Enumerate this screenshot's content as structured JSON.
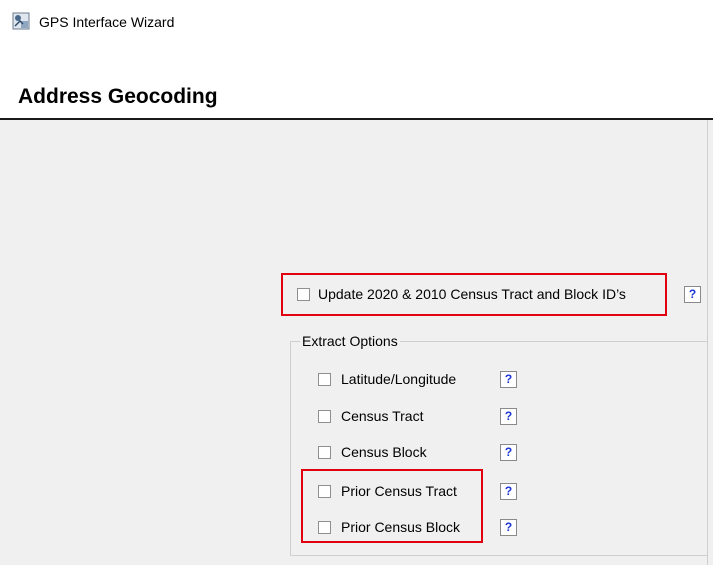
{
  "window": {
    "title": "GPS Interface Wizard",
    "icon": "gps-wizard-app-icon"
  },
  "header": {
    "title": "Address Geocoding"
  },
  "update_option": {
    "label": "Update 2020 & 2010 Census Tract and Block ID’s",
    "checked": false,
    "help": "?"
  },
  "extract_options": {
    "label": "Extract Options",
    "items": [
      {
        "label": "Latitude/Longitude",
        "checked": false,
        "help": "?"
      },
      {
        "label": "Census Tract",
        "checked": false,
        "help": "?"
      },
      {
        "label": "Census Block",
        "checked": false,
        "help": "?"
      },
      {
        "label": "Prior Census Tract",
        "checked": false,
        "help": "?"
      },
      {
        "label": "Prior Census Block",
        "checked": false,
        "help": "?"
      }
    ]
  },
  "colors": {
    "highlight": "#e0000f",
    "help_text": "#1b35d6",
    "content_bg": "#f0f0f0"
  }
}
